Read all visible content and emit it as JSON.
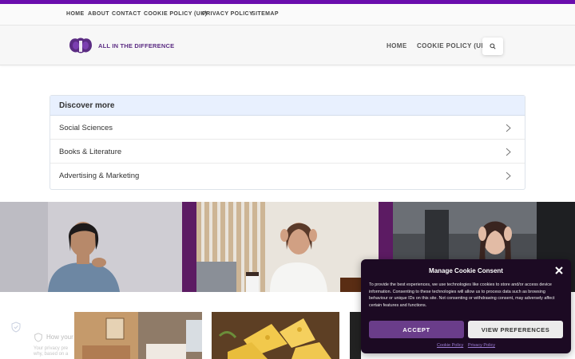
{
  "colors": {
    "accent": "#6a0dad",
    "brand_purple": "#5b2c83",
    "dialog_bg": "#1c0a23",
    "accept_bg": "#6a3d8a"
  },
  "topbar": {
    "items": [
      {
        "label": "HOME"
      },
      {
        "label": "ABOUT"
      },
      {
        "label": "CONTACT"
      },
      {
        "label": "COOKIE POLICY (UK)"
      },
      {
        "label": "PRIVACY POLICY"
      },
      {
        "label": "SITEMAP"
      }
    ]
  },
  "header": {
    "logo_text": "ALL IN THE DIFFERENCE",
    "nav": [
      {
        "label": "HOME"
      },
      {
        "label": "COOKIE POLICY (UK)"
      }
    ],
    "search_icon": "search-icon"
  },
  "discover": {
    "title": "Discover more",
    "items": [
      {
        "label": "Social Sciences"
      },
      {
        "label": "Books & Literature"
      },
      {
        "label": "Advertising & Marketing"
      }
    ]
  },
  "privacy_widget": {
    "title": "How your",
    "line1": "Your privacy pre",
    "line2": "why, based on a"
  },
  "cookie": {
    "title": "Manage Cookie Consent",
    "body": "To provide the best experiences, we use technologies like cookies to store and/or access device information. Consenting to these technologies will allow us to process data such as browsing behaviour or unique IDs on this site. Not consenting or withdrawing consent, may adversely affect certain features and functions.",
    "accept_label": "ACCEPT",
    "prefs_label": "VIEW PREFERENCES",
    "links": [
      {
        "label": "Cookie Policy"
      },
      {
        "label": "Privacy Policy"
      }
    ]
  }
}
